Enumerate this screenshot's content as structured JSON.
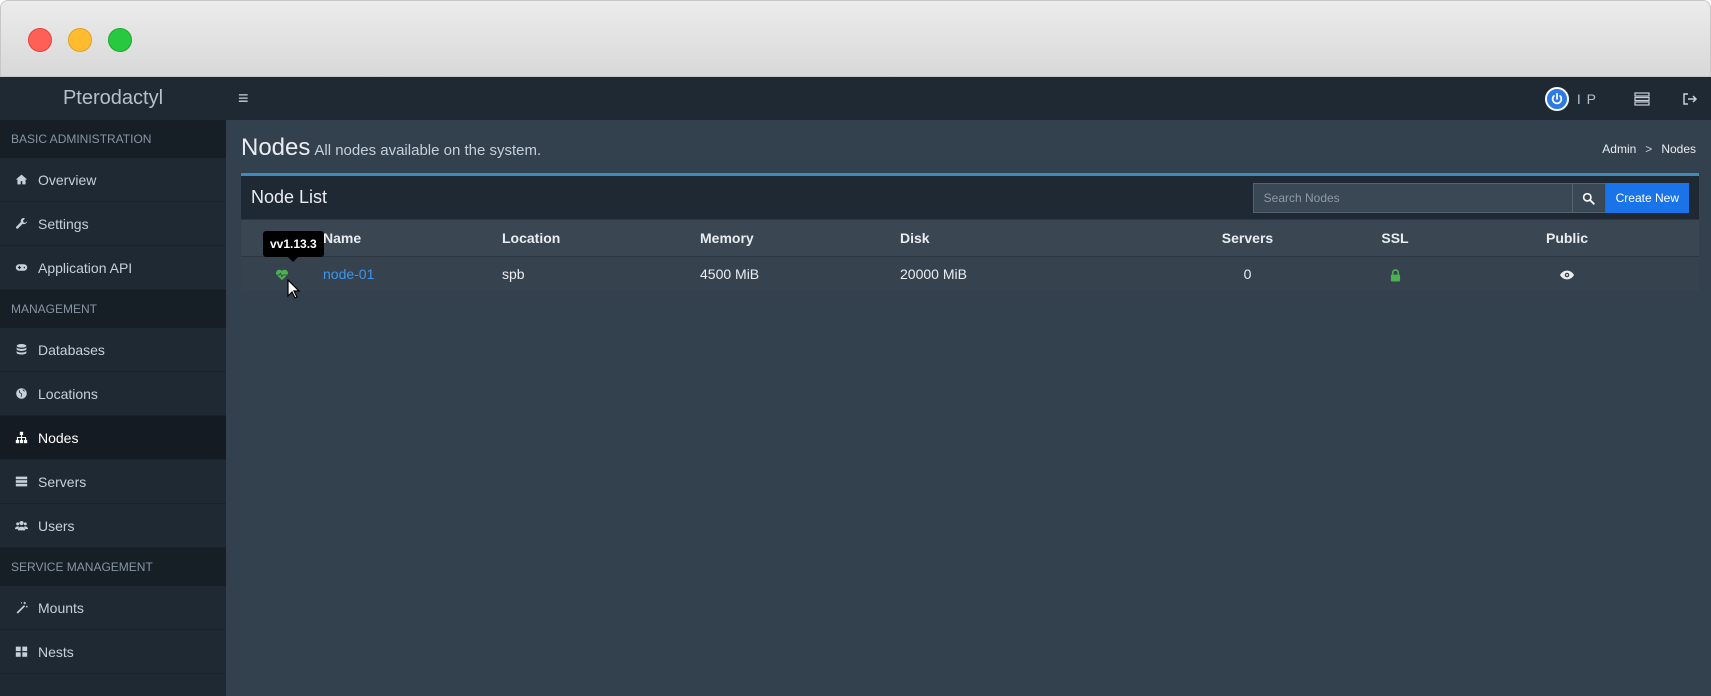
{
  "app": {
    "brand": "Pterodactyl",
    "user_label": "I P"
  },
  "sidebar": {
    "sections": [
      {
        "header": "Basic Administration",
        "items": [
          {
            "label": "Overview",
            "icon": "home-icon"
          },
          {
            "label": "Settings",
            "icon": "wrench-icon"
          },
          {
            "label": "Application API",
            "icon": "gamepad-icon"
          }
        ]
      },
      {
        "header": "Management",
        "items": [
          {
            "label": "Databases",
            "icon": "database-icon"
          },
          {
            "label": "Locations",
            "icon": "globe-icon"
          },
          {
            "label": "Nodes",
            "icon": "sitemap-icon",
            "active": true
          },
          {
            "label": "Servers",
            "icon": "server-icon"
          },
          {
            "label": "Users",
            "icon": "users-icon"
          }
        ]
      },
      {
        "header": "Service Management",
        "items": [
          {
            "label": "Mounts",
            "icon": "magic-icon"
          },
          {
            "label": "Nests",
            "icon": "th-large-icon"
          }
        ]
      }
    ]
  },
  "page": {
    "title": "Nodes",
    "subtitle": "All nodes available on the system.",
    "breadcrumb": [
      "Admin",
      ">",
      "Nodes"
    ]
  },
  "node_list": {
    "title": "Node List",
    "search_placeholder": "Search Nodes",
    "create_label": "Create New",
    "columns": [
      "Name",
      "Location",
      "Memory",
      "Disk",
      "Servers",
      "SSL",
      "Public"
    ],
    "rows": [
      {
        "name": "node-01",
        "location": "spb",
        "memory": "4500 MiB",
        "disk": "20000 MiB",
        "servers": "0",
        "ssl": "lock-icon",
        "public": "eye-icon",
        "status_icon": "heartbeat-icon"
      }
    ],
    "tooltip": "vv1.13.3"
  },
  "colors": {
    "accent": "#3c8dbc",
    "link": "#3b96f0",
    "button": "#1a73e8",
    "status_ok": "#4caf50"
  }
}
